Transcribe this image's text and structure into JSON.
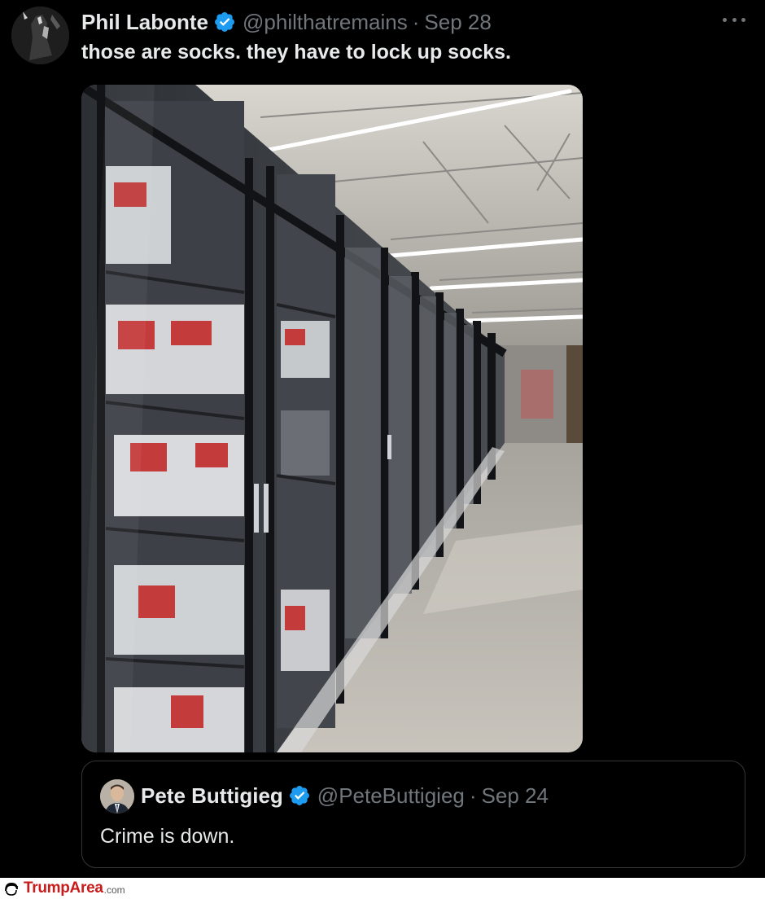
{
  "tweet": {
    "author_name": "Phil Labonte",
    "handle": "@philthatremains",
    "separator": "·",
    "date": "Sep 28",
    "text": "those are socks. they have to lock up socks."
  },
  "quoted_tweet": {
    "author_name": "Pete Buttigieg",
    "handle": "@PeteButtigieg",
    "separator": "·",
    "date": "Sep 24",
    "text": "Crime is down."
  },
  "footer": {
    "brand_name": "TrumpArea",
    "brand_tld": ".com",
    "logo_icon": "trump-hair-icon"
  },
  "icons": {
    "verified": "verified-badge-icon",
    "more": "more-options-icon"
  },
  "colors": {
    "background": "#000000",
    "text": "#e7e9ea",
    "muted": "#71767b",
    "verified_blue": "#1d9bf0",
    "brand_red": "#c81b1b"
  }
}
